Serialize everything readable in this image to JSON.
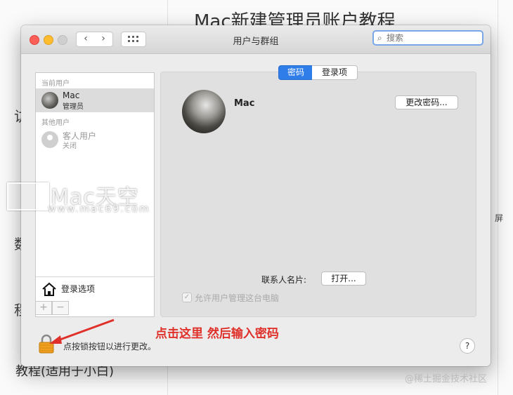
{
  "background": {
    "page_title": "Mac新建管理员账户教程",
    "bottom_text": "教程(适用于小白)"
  },
  "window": {
    "title": "用户与群组",
    "search_placeholder": "搜索"
  },
  "sidebar": {
    "current_users_header": "当前用户",
    "current_user": {
      "name": "Mac",
      "role": "管理员"
    },
    "other_users_header": "其他用户",
    "guest_user": {
      "name": "客人用户",
      "status": "关闭"
    },
    "login_options_label": "登录选项",
    "add_label": "+",
    "remove_label": "−"
  },
  "tabs": [
    {
      "label": "密码",
      "active": true
    },
    {
      "label": "登录项",
      "active": false
    }
  ],
  "main": {
    "user_name": "Mac",
    "change_password_button": "更改密码...",
    "contact_card_label": "联系人名片:",
    "open_button": "打开...",
    "allow_admin_label": "允许用户管理这台电脑",
    "allow_admin_checked": true
  },
  "footer": {
    "lock_text": "点按锁按钮以进行更改。",
    "help_label": "?"
  },
  "annotation": {
    "text": "点击这里 然后输入密码",
    "color": "#e0302a"
  },
  "watermark": {
    "brand": "Mac天空",
    "url": "www.mac69.com",
    "credit": "@稀土掘金技术社区"
  },
  "colors": {
    "accent": "#2f7de9",
    "close": "#fe5f57",
    "minimize": "#febc2e"
  }
}
